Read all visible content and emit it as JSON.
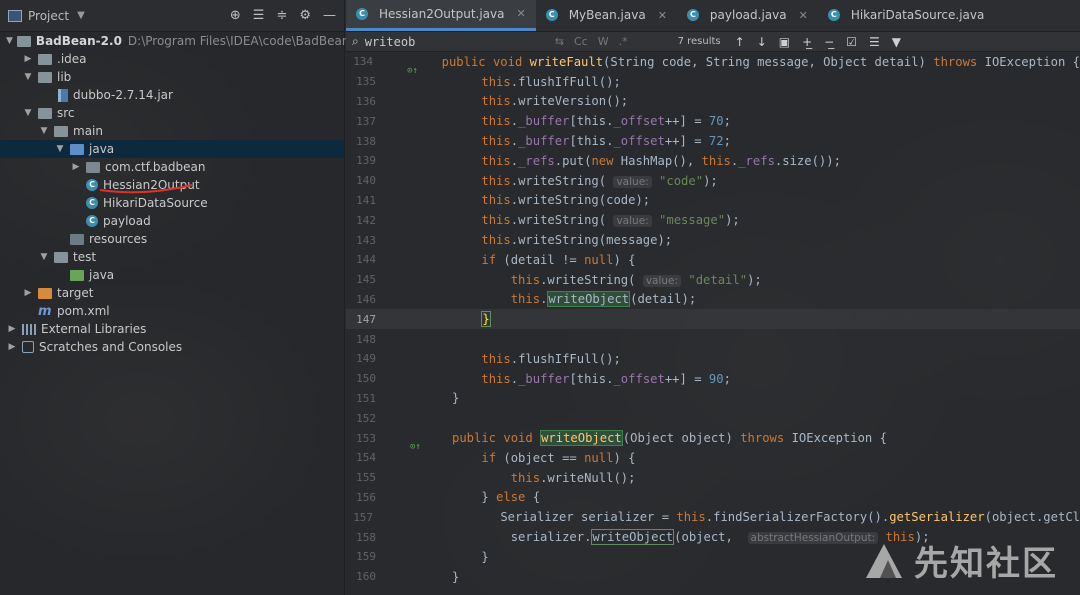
{
  "project_panel": {
    "title": "Project",
    "tree": [
      {
        "label": "BadBean-2.0",
        "extra": "D:\\Program Files\\IDEA\\code\\BadBean-2.0",
        "icon": "folder-icon"
      },
      {
        "label": ".idea",
        "icon": "folder-icon"
      },
      {
        "label": "lib",
        "icon": "folder-icon"
      },
      {
        "label": "dubbo-2.7.14.jar",
        "icon": "jar-icon"
      },
      {
        "label": "src",
        "icon": "folder-icon"
      },
      {
        "label": "main",
        "icon": "folder-icon"
      },
      {
        "label": "java",
        "icon": "source-folder-icon"
      },
      {
        "label": "com.ctf.badbean",
        "icon": "package-icon"
      },
      {
        "label": "Hessian2Output",
        "icon": "class-icon"
      },
      {
        "label": "HikariDataSource",
        "icon": "class-icon"
      },
      {
        "label": "payload",
        "icon": "class-icon"
      },
      {
        "label": "resources",
        "icon": "resources-folder-icon"
      },
      {
        "label": "test",
        "icon": "folder-icon"
      },
      {
        "label": "java",
        "icon": "test-folder-icon"
      },
      {
        "label": "target",
        "icon": "excluded-folder-icon"
      },
      {
        "label": "pom.xml",
        "icon": "maven-icon"
      },
      {
        "label": "External Libraries",
        "icon": "library-icon"
      },
      {
        "label": "Scratches and Consoles",
        "icon": "scratch-icon"
      }
    ]
  },
  "tabs": [
    {
      "label": "Hessian2Output.java",
      "active": true
    },
    {
      "label": "MyBean.java",
      "active": false
    },
    {
      "label": "payload.java",
      "active": false
    },
    {
      "label": "HikariDataSource.java",
      "active": false
    }
  ],
  "find": {
    "query": "writeob",
    "match_case": "Cc",
    "words": "W",
    "regex": ".*",
    "results": "7 results"
  },
  "code_lines": [
    "134",
    "135",
    "136",
    "137",
    "138",
    "139",
    "140",
    "141",
    "142",
    "143",
    "144",
    "145",
    "146",
    "147",
    "148",
    "149",
    "150",
    "151",
    "152",
    "153",
    "154",
    "155",
    "156",
    "157",
    "158",
    "159",
    "160"
  ],
  "code_text": {
    "l134a": "public void ",
    "l134b": "writeFault",
    "l134c": "(String code, String message, Object detail) ",
    "l134d": "throws ",
    "l134e": "IOException {",
    "l135": "flushIfFull();",
    "l136": "writeVersion();",
    "l137a": "_buffer",
    "l137b": "_offset",
    "l137c": "70",
    "l138c": "72",
    "l139a": "_refs",
    "l139b": ".put(",
    "l139c": "new ",
    "l139d": "HashMap(), ",
    "l139e": ".size());",
    "hint_value": "value:",
    "s_code": "\"code\"",
    "l141": "writeString(code);",
    "s_message": "\"message\"",
    "l143": "writeString(message);",
    "l144a": "if ",
    "l144b": "(detail != ",
    "l144c": "null",
    "l144d": ") {",
    "s_detail": "\"detail\"",
    "this": "this",
    "writeString_open": "writeString(",
    "close_paren": ");",
    "writeObject": "writeObject",
    "detail_arg": "(detail);",
    "brace_close": "}",
    "l150c": "90",
    "l153a": "public void ",
    "l153b": "writeObject",
    "l153c": "(Object object) ",
    "l153d": "throws ",
    "l153e": "IOException {",
    "l154a": "if ",
    "l154b": "(object == ",
    "l154c": "null",
    "l154d": ") {",
    "l155": "writeNull();",
    "l156a": "} ",
    "l156b": "else ",
    "l156c": "{",
    "l157a": "Serializer serializer = ",
    "l157b": "this",
    "l157c": ".findSerializerFactory().",
    "l157d": "getSerializer",
    "l157e": "(object.getCl",
    "l158a": "serializer.",
    "l158b": "writeObject",
    "l158c": "(object,  ",
    "hint_abstract": "abstractHessianOutput:",
    "l158e": " this",
    "dot": ".",
    "buf_assign": "[this.",
    "buf_inc": "++] = ",
    "semicolon": ";"
  },
  "watermark": "先知社区"
}
